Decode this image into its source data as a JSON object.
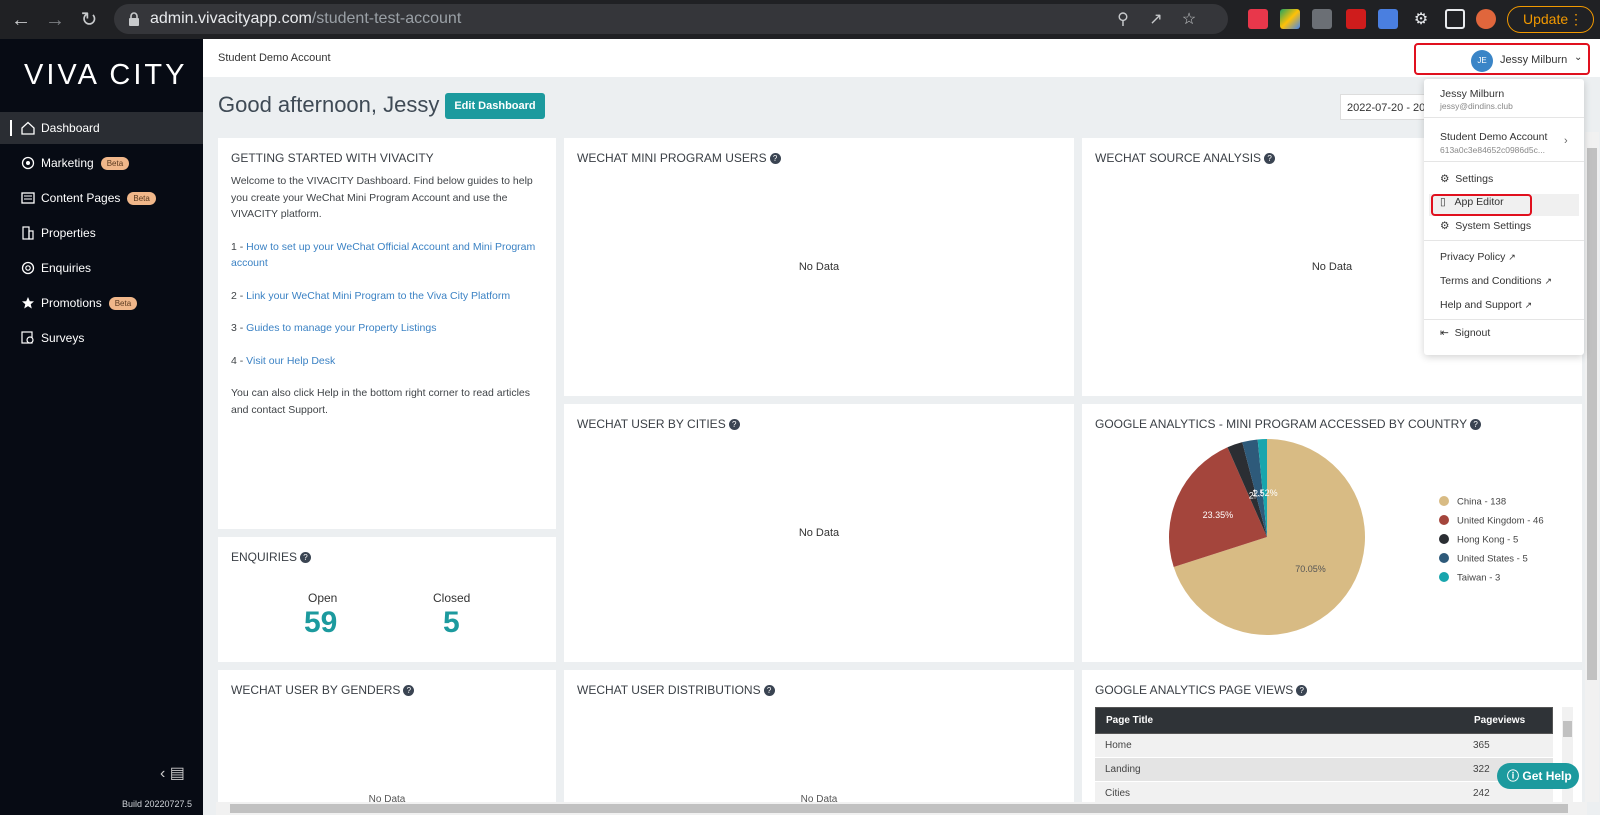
{
  "browser": {
    "url_host": "admin.vivacityapp.com",
    "url_path": "/student-test-account",
    "update_label": "Update"
  },
  "sidebar": {
    "logo": "VIVA CITY",
    "items": [
      {
        "label": "Dashboard",
        "icon": "home-icon",
        "beta": ""
      },
      {
        "label": "Marketing",
        "icon": "megaphone-icon",
        "beta": "Beta"
      },
      {
        "label": "Content Pages",
        "icon": "newspaper-icon",
        "beta": "Beta"
      },
      {
        "label": "Properties",
        "icon": "building-icon",
        "beta": ""
      },
      {
        "label": "Enquiries",
        "icon": "lifebuoy-icon",
        "beta": ""
      },
      {
        "label": "Promotions",
        "icon": "star-icon",
        "beta": "Beta"
      },
      {
        "label": "Surveys",
        "icon": "survey-icon",
        "beta": ""
      }
    ],
    "build": "Build 20220727.5"
  },
  "header": {
    "account_name": "Student Demo Account",
    "avatar_initials": "JE",
    "user_name": "Jessy Milburn"
  },
  "dashboard": {
    "greeting": "Good afternoon, Jessy",
    "edit_label": "Edit Dashboard",
    "date_range": "2022-07-20 - 2022-07-27"
  },
  "getting_started": {
    "title": "GETTING STARTED WITH VIVACITY",
    "intro": "Welcome to the VIVACITY Dashboard. Find below guides to help you create your WeChat Mini Program Account and use the VIVACITY platform.",
    "links": [
      {
        "prefix": "1 - ",
        "text": "How to set up your WeChat Official Account and Mini Program account"
      },
      {
        "prefix": "2 - ",
        "text": "Link your WeChat Mini Program to the Viva City Platform"
      },
      {
        "prefix": "3 - ",
        "text": "Guides to manage your Property Listings"
      },
      {
        "prefix": "4 - ",
        "text": "Visit our Help Desk"
      }
    ],
    "footer": "You can also click Help in the bottom right corner to read articles and contact Support."
  },
  "cards": {
    "wechat_users": "WECHAT MINI PROGRAM USERS",
    "wechat_source": "WECHAT SOURCE ANALYSIS",
    "wechat_cities": "WECHAT USER BY CITIES",
    "ga_country": "GOOGLE ANALYTICS - MINI PROGRAM ACCESSED BY COUNTRY",
    "enquiries": "ENQUIRIES",
    "genders": "WECHAT USER BY GENDERS",
    "distributions": "WECHAT USER DISTRIBUTIONS",
    "ga_pageviews": "GOOGLE ANALYTICS PAGE VIEWS",
    "no_data": "No Data"
  },
  "enquiries": {
    "open_label": "Open",
    "open_value": "59",
    "closed_label": "Closed",
    "closed_value": "5"
  },
  "chart_data": {
    "type": "pie",
    "title": "GOOGLE ANALYTICS - MINI PROGRAM ACCESSED BY COUNTRY",
    "legend_position": "right",
    "slices": [
      {
        "label": "China - 138",
        "value": 138,
        "color": "#d8bb84",
        "pct_label": "70.05%"
      },
      {
        "label": "United Kingdom - 46",
        "value": 46,
        "color": "#a4453c",
        "pct_label": "23.35%"
      },
      {
        "label": "Hong Kong - 5",
        "value": 5,
        "color": "#2b2e33",
        "pct_label": "2."
      },
      {
        "label": "United States - 5",
        "value": 5,
        "color": "#2e5a7a",
        "pct_label": "2.5"
      },
      {
        "label": "Taiwan - 3",
        "value": 3,
        "color": "#18a5ad",
        "pct_label": "1.52%"
      }
    ]
  },
  "pageviews": {
    "col_title": "Page Title",
    "col_views": "Pageviews",
    "rows": [
      {
        "title": "Home",
        "views": "365"
      },
      {
        "title": "Landing",
        "views": "322"
      },
      {
        "title": "Cities",
        "views": "242"
      }
    ]
  },
  "help_button": "Get Help",
  "dropdown": {
    "name": "Jessy Milburn",
    "email": "jessy@dindins.club",
    "account": "Student Demo Account",
    "account_id": "613a0c3e84652c0986d5c...",
    "settings": "Settings",
    "app_editor": "App Editor",
    "system_settings": "System Settings",
    "privacy": "Privacy Policy",
    "terms": "Terms and Conditions",
    "help": "Help and Support",
    "signout": "Signout"
  }
}
